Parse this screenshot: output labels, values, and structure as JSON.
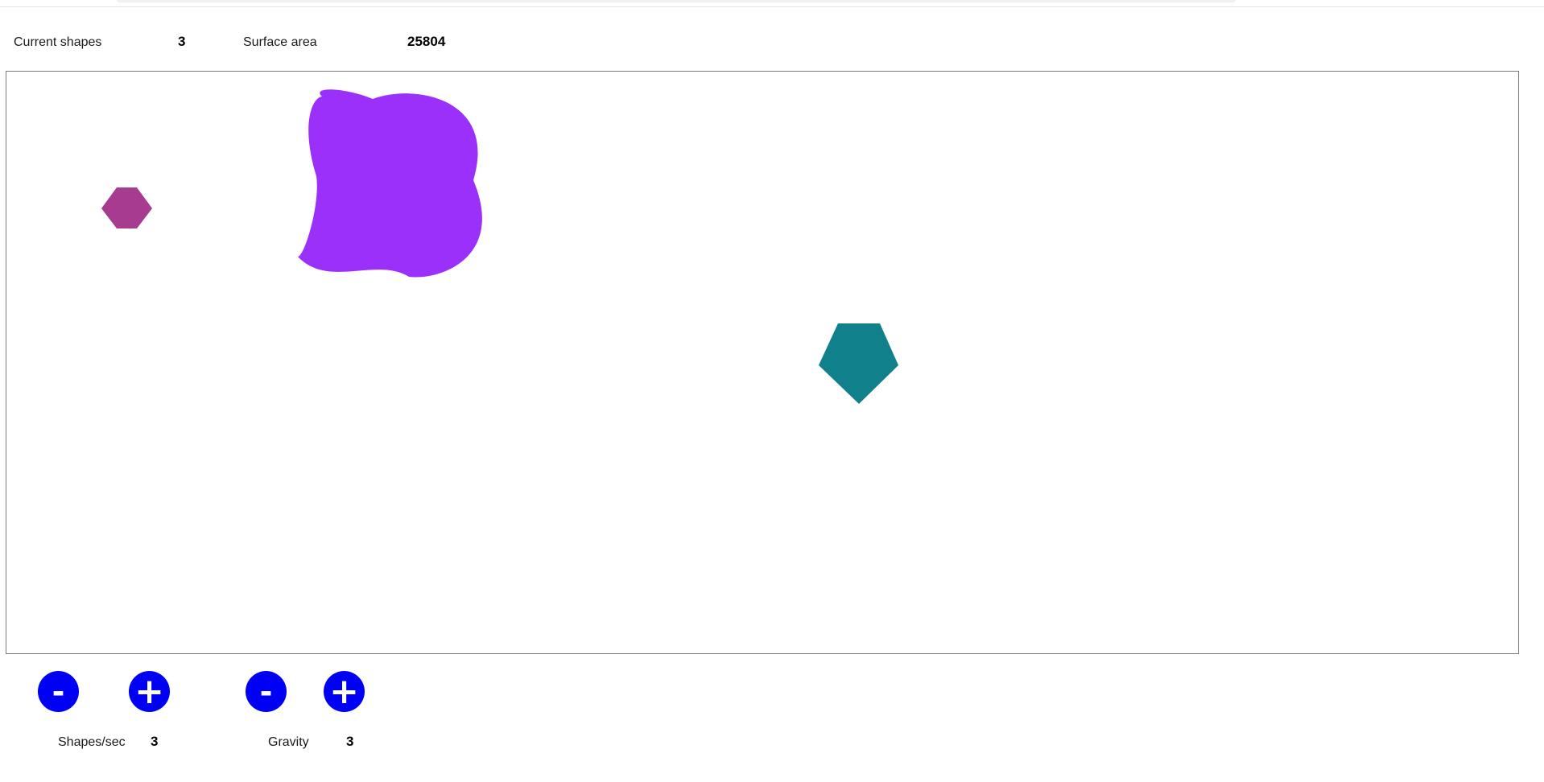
{
  "stats": {
    "current_shapes_label": "Current shapes",
    "current_shapes_value": "3",
    "surface_area_label": "Surface area",
    "surface_area_value": "25804"
  },
  "shapes": [
    {
      "kind": "hexagon",
      "color": "#a63b8f"
    },
    {
      "kind": "blob",
      "color": "#9b30fa"
    },
    {
      "kind": "pentagon",
      "color": "#10808a"
    }
  ],
  "controls": {
    "shapes_per_sec": {
      "minus_label": "-",
      "plus_label": "+",
      "label": "Shapes/sec",
      "value": "3"
    },
    "gravity": {
      "minus_label": "-",
      "plus_label": "+",
      "label": "Gravity",
      "value": "3"
    },
    "button_color": "#0000f5"
  }
}
